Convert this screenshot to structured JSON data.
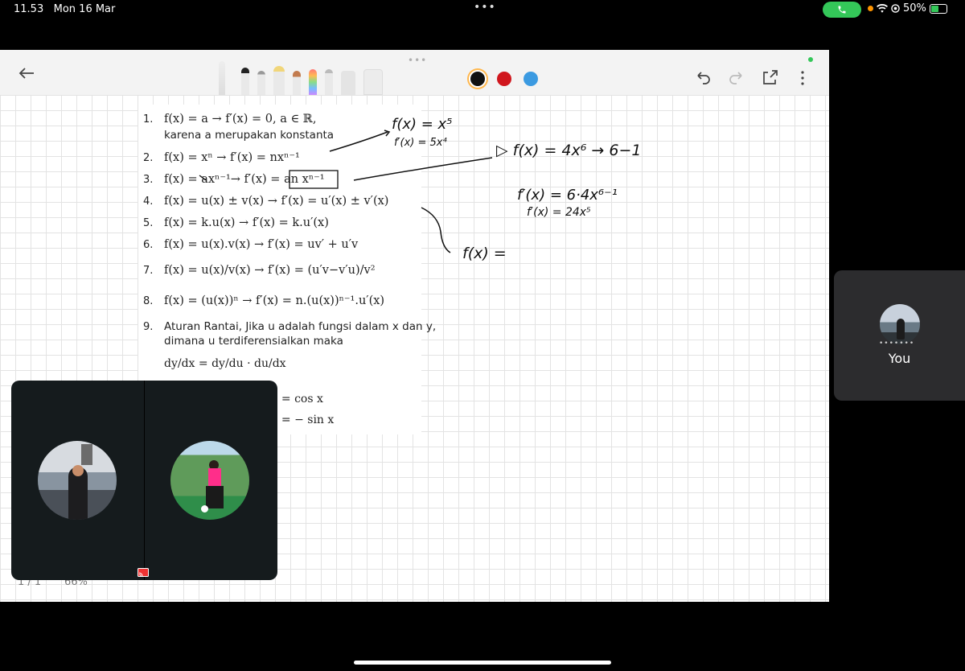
{
  "status_bar": {
    "time": "11.53",
    "date": "Mon 16 Mar",
    "battery": "50%",
    "accent_call": "#34c759"
  },
  "toolbar": {
    "icons": [
      "back-arrow-icon",
      "pen-tools",
      "undo-icon",
      "redo-icon",
      "share-icon",
      "more-icon"
    ],
    "colors": [
      "#111111",
      "#d0161d",
      "#3b9ae1"
    ]
  },
  "sheet": {
    "items": [
      {
        "n": "1.",
        "text": "f(x) = a  → f′(x) = 0, a ∈ ℝ,"
      },
      {
        "n": "2.",
        "text": "f(x) = xⁿ  → f′(x) = nxⁿ⁻¹"
      },
      {
        "n": "3.",
        "text": "f(x) = axⁿ⁻¹→ f′(x) = an xⁿ⁻¹"
      },
      {
        "n": "4.",
        "text": "f(x) = u(x) ± v(x) →  f′(x) = u′(x) ± v′(x)"
      },
      {
        "n": "5.",
        "text": "f(x) = k.u(x) → f′(x) = k.u′(x)"
      },
      {
        "n": "6.",
        "text": "f(x) = u(x).v(x) →  f′(x) = uv′ + u′v"
      },
      {
        "n": "7.",
        "text": "f(x) = u(x)/v(x)  → f′(x) = (u′v−v′u)/v²"
      },
      {
        "n": "8.",
        "text": "f(x) = (u(x))ⁿ → f′(x) = n.(u(x))ⁿ⁻¹.u′(x)"
      },
      {
        "n": "9.",
        "text": "Aturan Rantai, Jika u adalah fungsi dalam x dan y,"
      }
    ],
    "item1_sub": "karena a merupakan konstanta",
    "item9_sub": "dimana u terdiferensialkan maka",
    "chain_rule": "dy/dx = dy/du · du/dx",
    "cos_line": ") = cos x",
    "sin_line": ") = − sin x"
  },
  "handwriting": {
    "h1": "f(x) = x⁵",
    "h2": "f′(x) = 5x⁴",
    "h3": "▷  f(x) = 4x⁶  → 6−1",
    "h4": "f′(x) = 6·4x⁶⁻¹",
    "h5": "f′(x) = 24x⁵",
    "h6": "f(x) ="
  },
  "footer": {
    "page": "1 / 1",
    "zoom": "66%"
  },
  "participant": {
    "you_label": "You"
  }
}
